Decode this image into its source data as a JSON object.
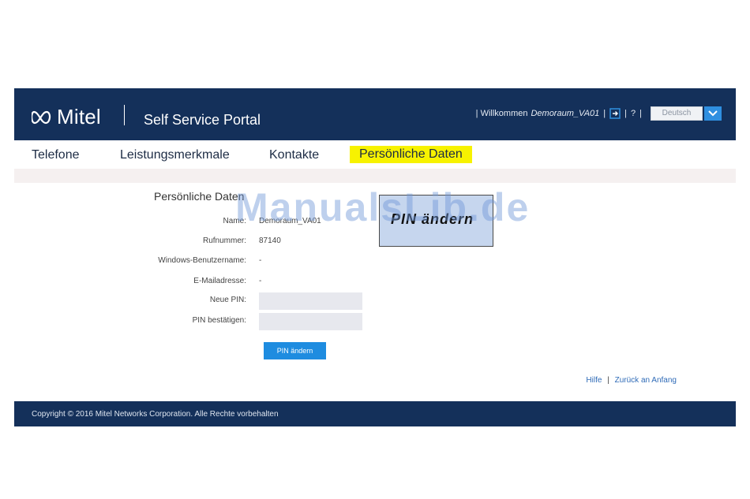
{
  "header": {
    "logo_text": "Mitel",
    "portal_title": "Self Service Portal",
    "welcome_prefix": "| Willkommen",
    "username": "Demoraum_VA01",
    "help_label": "?",
    "language": "Deutsch",
    "colors": {
      "header_bg": "#14305a",
      "accent": "#2f8fe0",
      "highlight": "#f7f200"
    }
  },
  "nav": {
    "items": [
      {
        "label": "Telefone"
      },
      {
        "label": "Leistungsmerkmale"
      },
      {
        "label": "Kontakte"
      },
      {
        "label": "Persönliche Daten",
        "active": true
      }
    ]
  },
  "main": {
    "section_title": "Persönliche Daten",
    "fields": [
      {
        "label": "Name:",
        "value": "Demoraum_VA01"
      },
      {
        "label": "Rufnummer:",
        "value": "87140"
      },
      {
        "label": "Windows-Benutzername:",
        "value": "-"
      },
      {
        "label": "E-Mailadresse:",
        "value": "-"
      },
      {
        "label": "Neue PIN:",
        "value": ""
      },
      {
        "label": "PIN bestätigen:",
        "value": ""
      }
    ],
    "submit_label": "PIN ändern"
  },
  "popup": {
    "text": "PIN ändern"
  },
  "watermark": "ManualsLib.de",
  "footer": {
    "help_link": "Hilfe",
    "top_link": "Zurück an Anfang",
    "copyright": "Copyright © 2016 Mitel Networks Corporation. Alle Rechte vorbehalten"
  }
}
